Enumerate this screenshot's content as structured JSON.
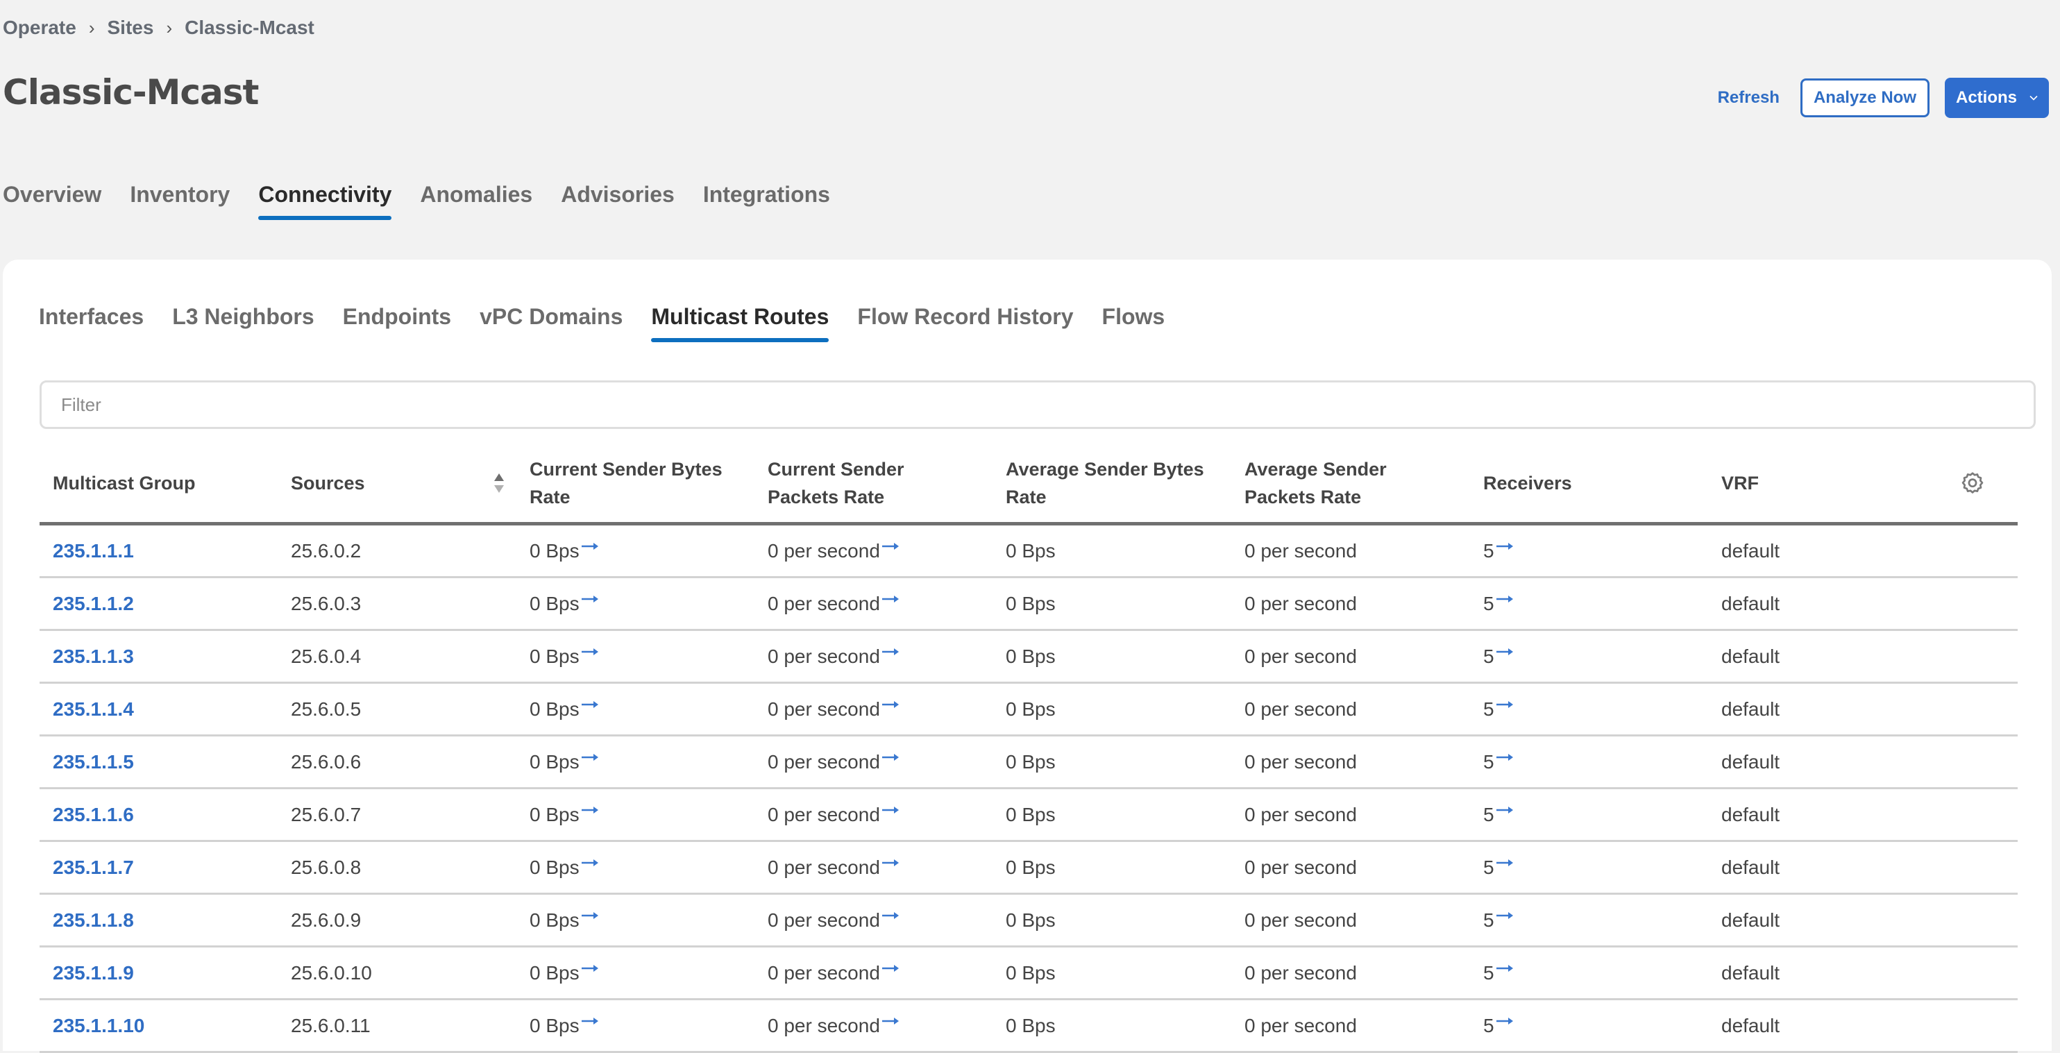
{
  "breadcrumb": [
    "Operate",
    "Sites",
    "Classic-Mcast"
  ],
  "breadcrumb_separator": "›",
  "page_title": "Classic-Mcast",
  "header_actions": {
    "refresh_label": "Refresh",
    "analyze_label": "Analyze Now",
    "actions_label": "Actions"
  },
  "main_tabs": [
    {
      "label": "Overview",
      "active": false
    },
    {
      "label": "Inventory",
      "active": false
    },
    {
      "label": "Connectivity",
      "active": true
    },
    {
      "label": "Anomalies",
      "active": false
    },
    {
      "label": "Advisories",
      "active": false
    },
    {
      "label": "Integrations",
      "active": false
    }
  ],
  "sub_tabs": [
    {
      "label": "Interfaces",
      "active": false
    },
    {
      "label": "L3 Neighbors",
      "active": false
    },
    {
      "label": "Endpoints",
      "active": false
    },
    {
      "label": "vPC Domains",
      "active": false
    },
    {
      "label": "Multicast Routes",
      "active": true
    },
    {
      "label": "Flow Record History",
      "active": false
    },
    {
      "label": "Flows",
      "active": false
    }
  ],
  "filter": {
    "placeholder": "Filter",
    "value": ""
  },
  "table": {
    "columns": [
      "Multicast Group",
      "Sources",
      "Current Sender Bytes Rate",
      "Current Sender Packets Rate",
      "Average Sender Bytes Rate",
      "Average Sender Packets Rate",
      "Receivers",
      "VRF"
    ],
    "sorted_column": "Sources",
    "rows": [
      {
        "group": "235.1.1.1",
        "source": "25.6.0.2",
        "cur_bytes": "0 Bps",
        "cur_packets": "0 per second",
        "avg_bytes": "0 Bps",
        "avg_packets": "0 per second",
        "receivers": "5",
        "vrf": "default"
      },
      {
        "group": "235.1.1.2",
        "source": "25.6.0.3",
        "cur_bytes": "0 Bps",
        "cur_packets": "0 per second",
        "avg_bytes": "0 Bps",
        "avg_packets": "0 per second",
        "receivers": "5",
        "vrf": "default"
      },
      {
        "group": "235.1.1.3",
        "source": "25.6.0.4",
        "cur_bytes": "0 Bps",
        "cur_packets": "0 per second",
        "avg_bytes": "0 Bps",
        "avg_packets": "0 per second",
        "receivers": "5",
        "vrf": "default"
      },
      {
        "group": "235.1.1.4",
        "source": "25.6.0.5",
        "cur_bytes": "0 Bps",
        "cur_packets": "0 per second",
        "avg_bytes": "0 Bps",
        "avg_packets": "0 per second",
        "receivers": "5",
        "vrf": "default"
      },
      {
        "group": "235.1.1.5",
        "source": "25.6.0.6",
        "cur_bytes": "0 Bps",
        "cur_packets": "0 per second",
        "avg_bytes": "0 Bps",
        "avg_packets": "0 per second",
        "receivers": "5",
        "vrf": "default"
      },
      {
        "group": "235.1.1.6",
        "source": "25.6.0.7",
        "cur_bytes": "0 Bps",
        "cur_packets": "0 per second",
        "avg_bytes": "0 Bps",
        "avg_packets": "0 per second",
        "receivers": "5",
        "vrf": "default"
      },
      {
        "group": "235.1.1.7",
        "source": "25.6.0.8",
        "cur_bytes": "0 Bps",
        "cur_packets": "0 per second",
        "avg_bytes": "0 Bps",
        "avg_packets": "0 per second",
        "receivers": "5",
        "vrf": "default"
      },
      {
        "group": "235.1.1.8",
        "source": "25.6.0.9",
        "cur_bytes": "0 Bps",
        "cur_packets": "0 per second",
        "avg_bytes": "0 Bps",
        "avg_packets": "0 per second",
        "receivers": "5",
        "vrf": "default"
      },
      {
        "group": "235.1.1.9",
        "source": "25.6.0.10",
        "cur_bytes": "0 Bps",
        "cur_packets": "0 per second",
        "avg_bytes": "0 Bps",
        "avg_packets": "0 per second",
        "receivers": "5",
        "vrf": "default"
      },
      {
        "group": "235.1.1.10",
        "source": "25.6.0.11",
        "cur_bytes": "0 Bps",
        "cur_packets": "0 per second",
        "avg_bytes": "0 Bps",
        "avg_packets": "0 per second",
        "receivers": "5",
        "vrf": "default"
      }
    ]
  },
  "colors": {
    "accent": "#2f6dc4",
    "tab_underline": "#0d6fbf",
    "background": "#f2f2f2",
    "card": "#ffffff"
  },
  "icons": {
    "breadcrumb_separator": "chevron-right-icon",
    "actions_dropdown": "chevron-down-icon",
    "sort": "sort-icon",
    "table_settings": "gear-icon",
    "drilldown": "arrow-right-icon"
  }
}
